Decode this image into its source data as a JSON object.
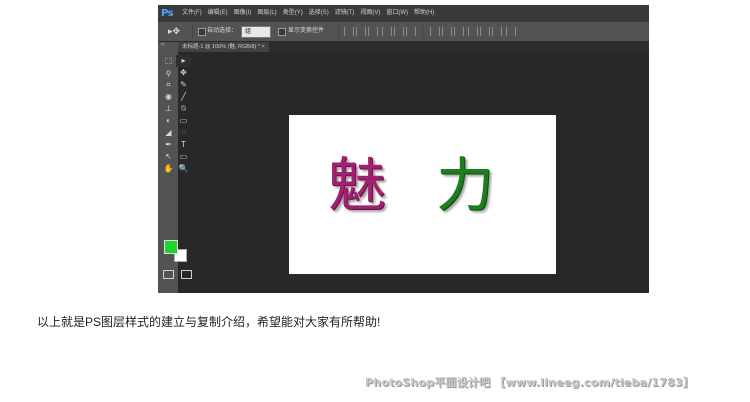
{
  "app": {
    "logo": "Ps"
  },
  "menu": [
    "文件(F)",
    "编辑(E)",
    "图像(I)",
    "图层(L)",
    "类型(Y)",
    "选择(S)",
    "滤镜(T)",
    "视图(V)",
    "窗口(W)",
    "帮助(H)"
  ],
  "options_bar": {
    "auto_select_label": "自动选择：",
    "auto_select_value": "组",
    "show_transform_label": "显示变换控件"
  },
  "document_tab": {
    "title": "未标题-1 @ 100% (魅, RGB/8) *",
    "close": "×"
  },
  "toolbox": {
    "tools": [
      "⬚",
      "▸",
      "ϙ",
      "✥",
      "⌗",
      "✎",
      "◉",
      "╱",
      "⊥",
      "⍉",
      "◐",
      "▭",
      "◢",
      "◌",
      "✒",
      "T",
      "↖",
      "▭",
      "✋",
      "🔍"
    ],
    "foreground_color": "#1fd42a",
    "background_color": "#ffffff"
  },
  "canvas": {
    "char1": "魅",
    "char2": "力",
    "char1_color": "#a0216e",
    "char2_color": "#1e7d1e"
  },
  "caption": "以上就是PS图层样式的建立与复制介绍，希望能对大家有所帮助!",
  "watermark": "PhotoShop平面设计吧 【www.lineeg.com/tieba/1783】"
}
